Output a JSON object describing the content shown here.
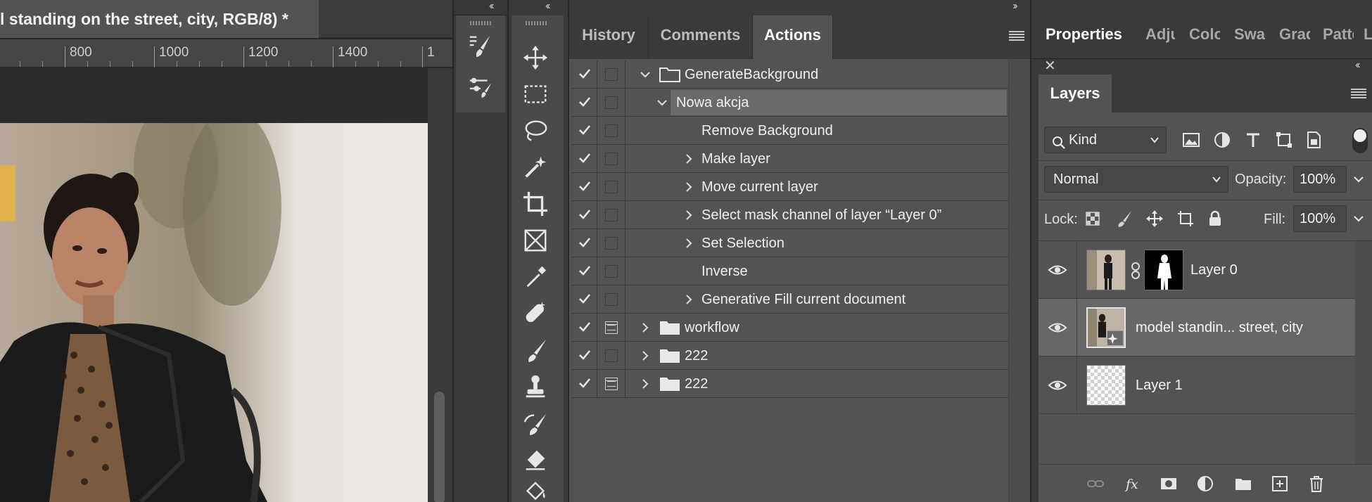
{
  "document": {
    "tab_title": "l standing on the street, city, RGB/8) *",
    "ruler_ticks": [
      "800",
      "1000",
      "1200",
      "1400",
      "1"
    ]
  },
  "actions_panel": {
    "tabs": [
      "History",
      "Comments",
      "Actions"
    ],
    "active_tab": "Actions",
    "rows": [
      {
        "label": "GenerateBackground",
        "checked": true,
        "dialog": false,
        "expand": "open",
        "folder": true
      },
      {
        "label": "Nowa akcja",
        "checked": true,
        "dialog": false,
        "expand": "open",
        "folder": false,
        "selected": true
      },
      {
        "label": "Remove Background",
        "checked": true,
        "dialog": false,
        "expand": "none"
      },
      {
        "label": "Make layer",
        "checked": true,
        "dialog": false,
        "expand": "closed"
      },
      {
        "label": "Move current layer",
        "checked": true,
        "dialog": false,
        "expand": "closed"
      },
      {
        "label": "Select mask channel of layer “Layer 0”",
        "checked": true,
        "dialog": false,
        "expand": "closed"
      },
      {
        "label": "Set Selection",
        "checked": true,
        "dialog": false,
        "expand": "closed"
      },
      {
        "label": "Inverse",
        "checked": true,
        "dialog": false,
        "expand": "none"
      },
      {
        "label": "Generative Fill current document",
        "checked": true,
        "dialog": false,
        "expand": "closed"
      },
      {
        "label": "workflow",
        "checked": true,
        "dialog": true,
        "expand": "closed",
        "folder": true
      },
      {
        "label": "222",
        "checked": true,
        "dialog": false,
        "expand": "closed",
        "folder": true
      },
      {
        "label": "222",
        "checked": true,
        "dialog": true,
        "expand": "closed",
        "folder": true
      }
    ]
  },
  "properties_tabs": [
    "Properties",
    "Adju",
    "Colo",
    "Swat",
    "Grad",
    "Patte",
    "L"
  ],
  "layers_panel": {
    "title": "Layers",
    "filter_kind": "Kind",
    "blend_mode": "Normal",
    "opacity_label": "Opacity:",
    "opacity_value": "100%",
    "lock_label": "Lock:",
    "fill_label": "Fill:",
    "fill_value": "100%",
    "layers": [
      {
        "name": "Layer 0",
        "visible": true,
        "has_mask": true,
        "selected": false
      },
      {
        "name": "model standin... street, city",
        "visible": true,
        "has_mask": false,
        "selected": true
      },
      {
        "name": "Layer 1",
        "visible": true,
        "has_mask": false,
        "selected": false
      }
    ]
  },
  "colors": {
    "panel_bg": "#535353",
    "app_bg": "#3a3a3a",
    "selected_row": "#676767",
    "text": "#f0f0f0"
  }
}
